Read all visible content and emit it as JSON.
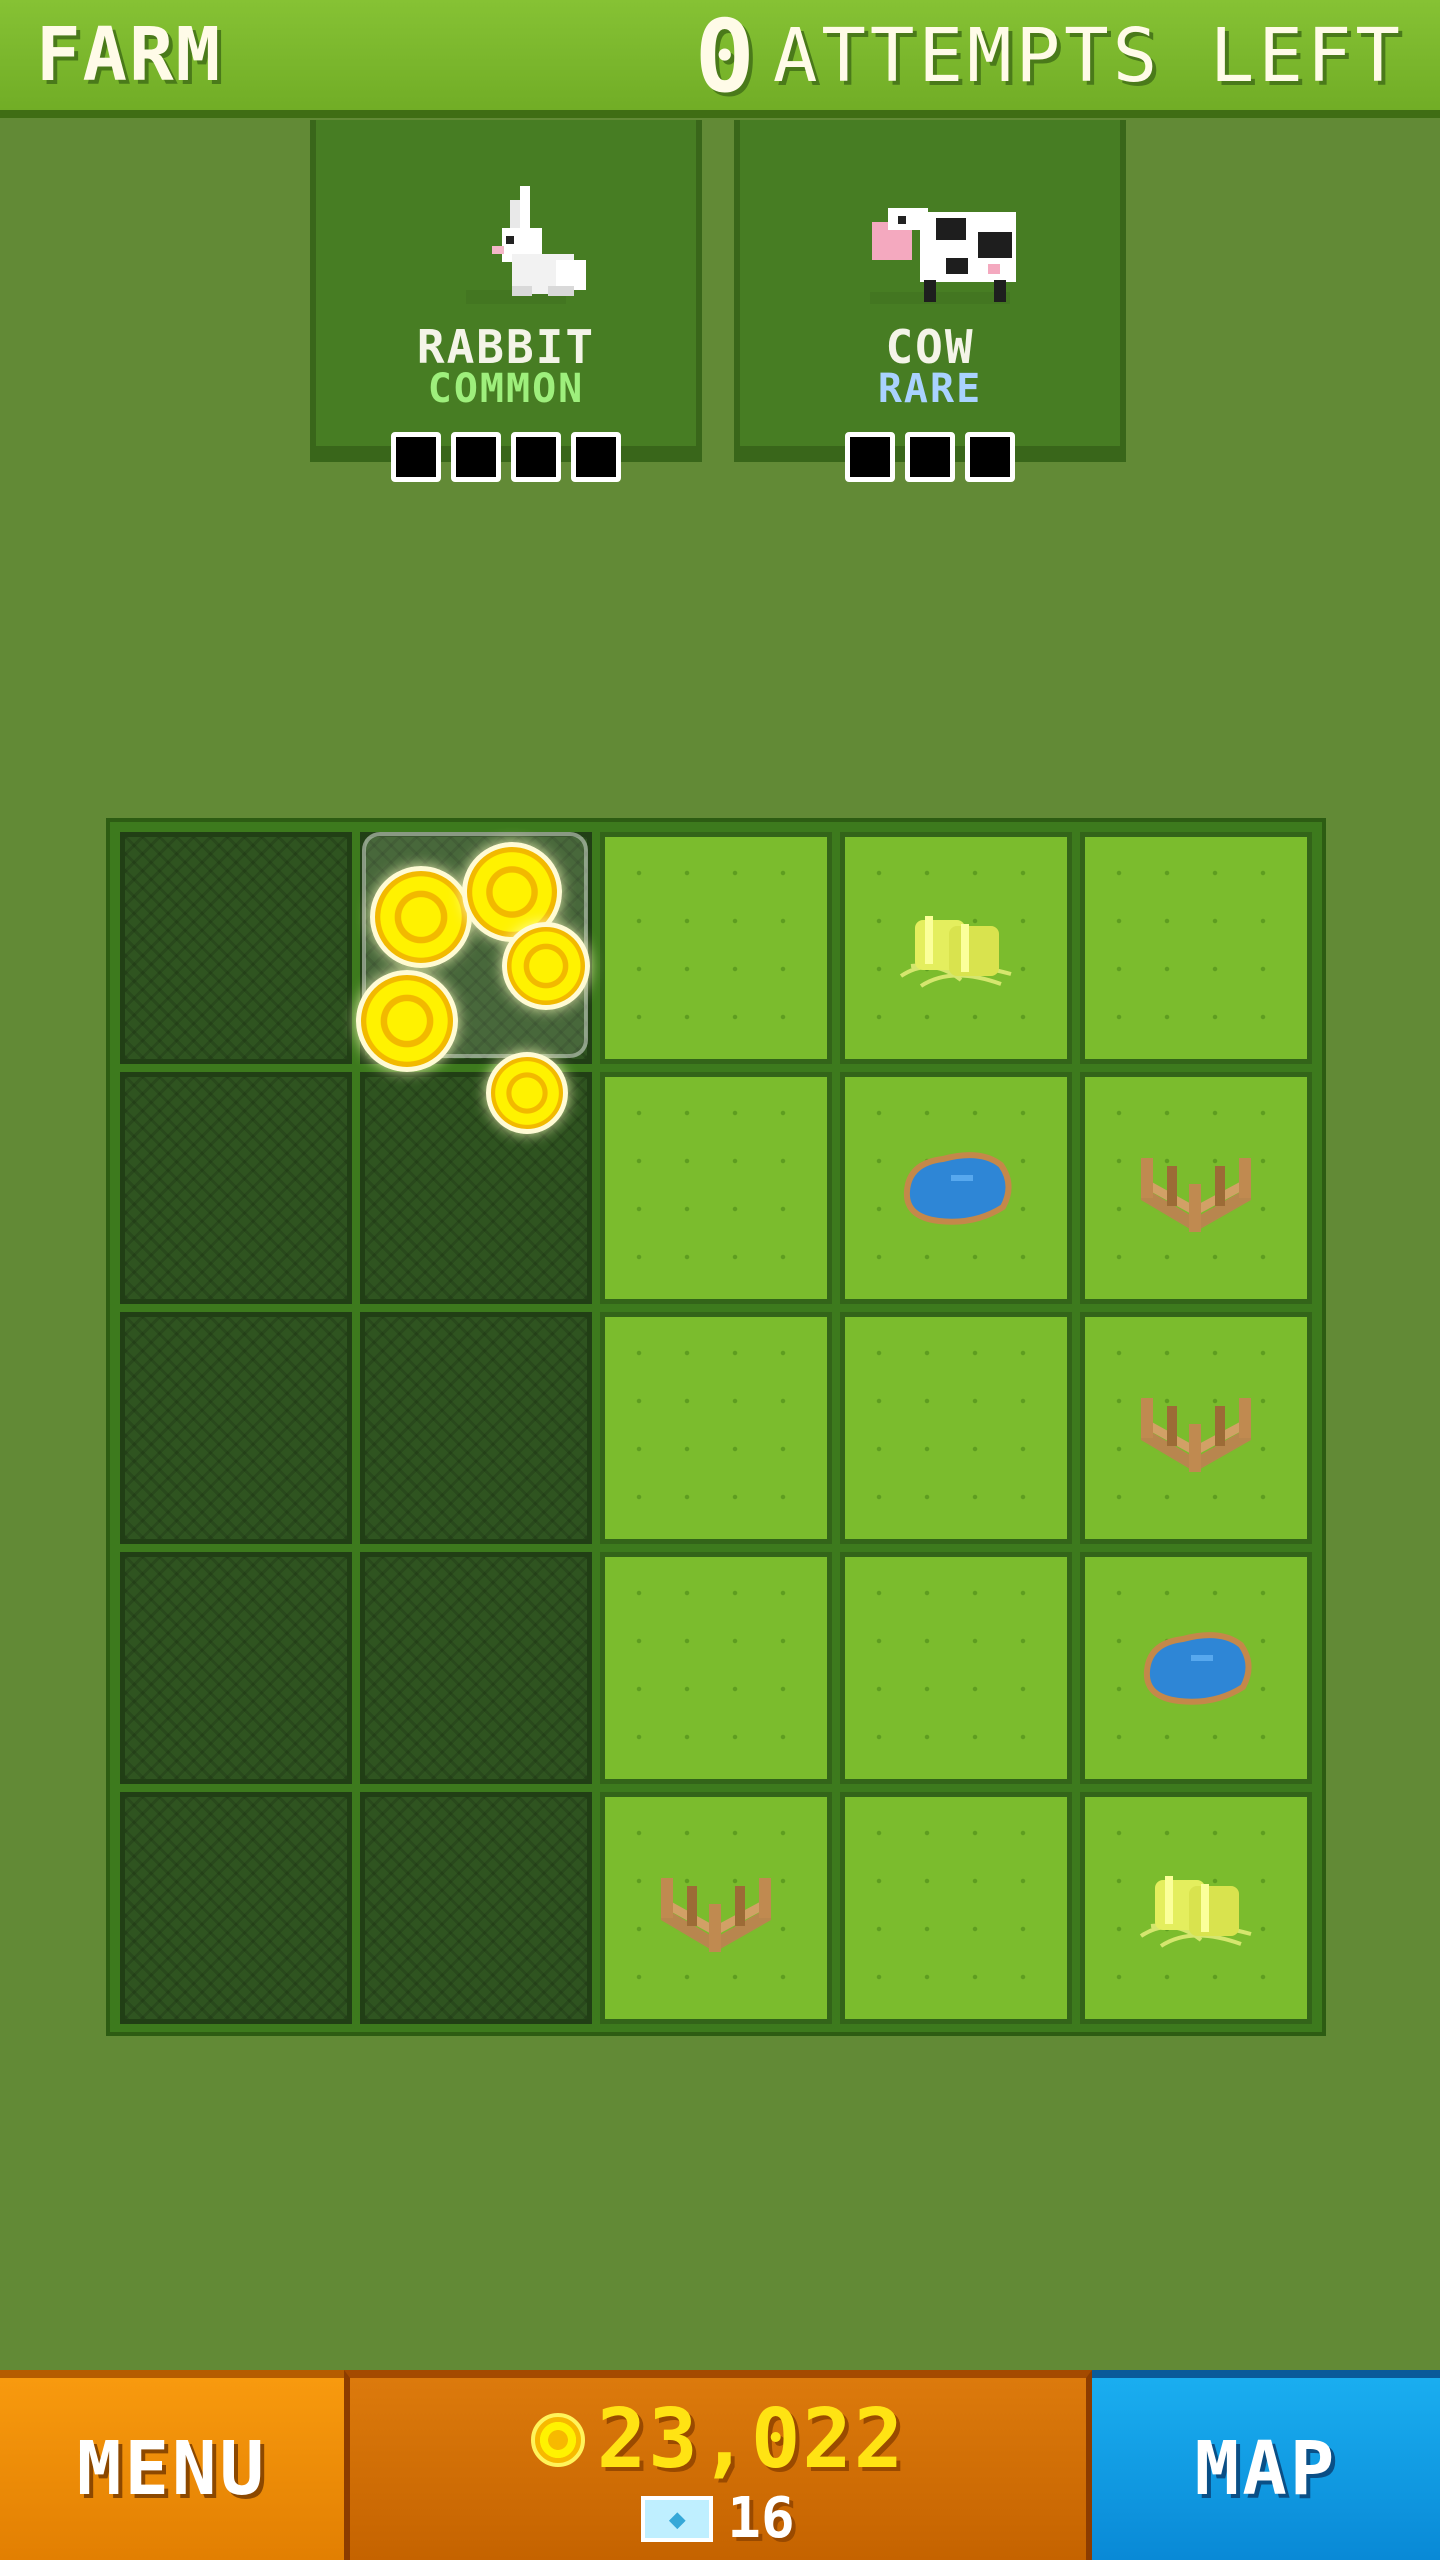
{
  "header": {
    "title": "FARM",
    "attempts_count": "0",
    "attempts_label": "ATTEMPTS LEFT"
  },
  "animals": [
    {
      "name": "RABBIT",
      "rarity": "COMMON",
      "rarity_color": "#9eef7c",
      "slots": 4,
      "icon": "rabbit-icon"
    },
    {
      "name": "COW",
      "rarity": "RARE",
      "rarity_color": "#a9d2ff",
      "slots": 3,
      "icon": "cow-icon"
    }
  ],
  "board": {
    "rows": 5,
    "cols": 5,
    "tiles": [
      [
        "dark",
        "revealed-coins",
        "grass",
        "hay",
        "grass"
      ],
      [
        "dark",
        "dark",
        "grass",
        "pond",
        "fence"
      ],
      [
        "dark",
        "dark",
        "grass",
        "grass",
        "fence"
      ],
      [
        "dark",
        "dark",
        "grass",
        "grass",
        "pond"
      ],
      [
        "dark",
        "dark",
        "fence",
        "grass",
        "hay"
      ]
    ]
  },
  "footer": {
    "menu_label": "MENU",
    "coins": "23,022",
    "gems": "16",
    "map_label": "MAP"
  },
  "colors": {
    "background": "#628a36",
    "header": "#7bb82d",
    "menu_button": "#f08c08",
    "map_button": "#0fa0e6",
    "coin_text": "#ffe313"
  }
}
